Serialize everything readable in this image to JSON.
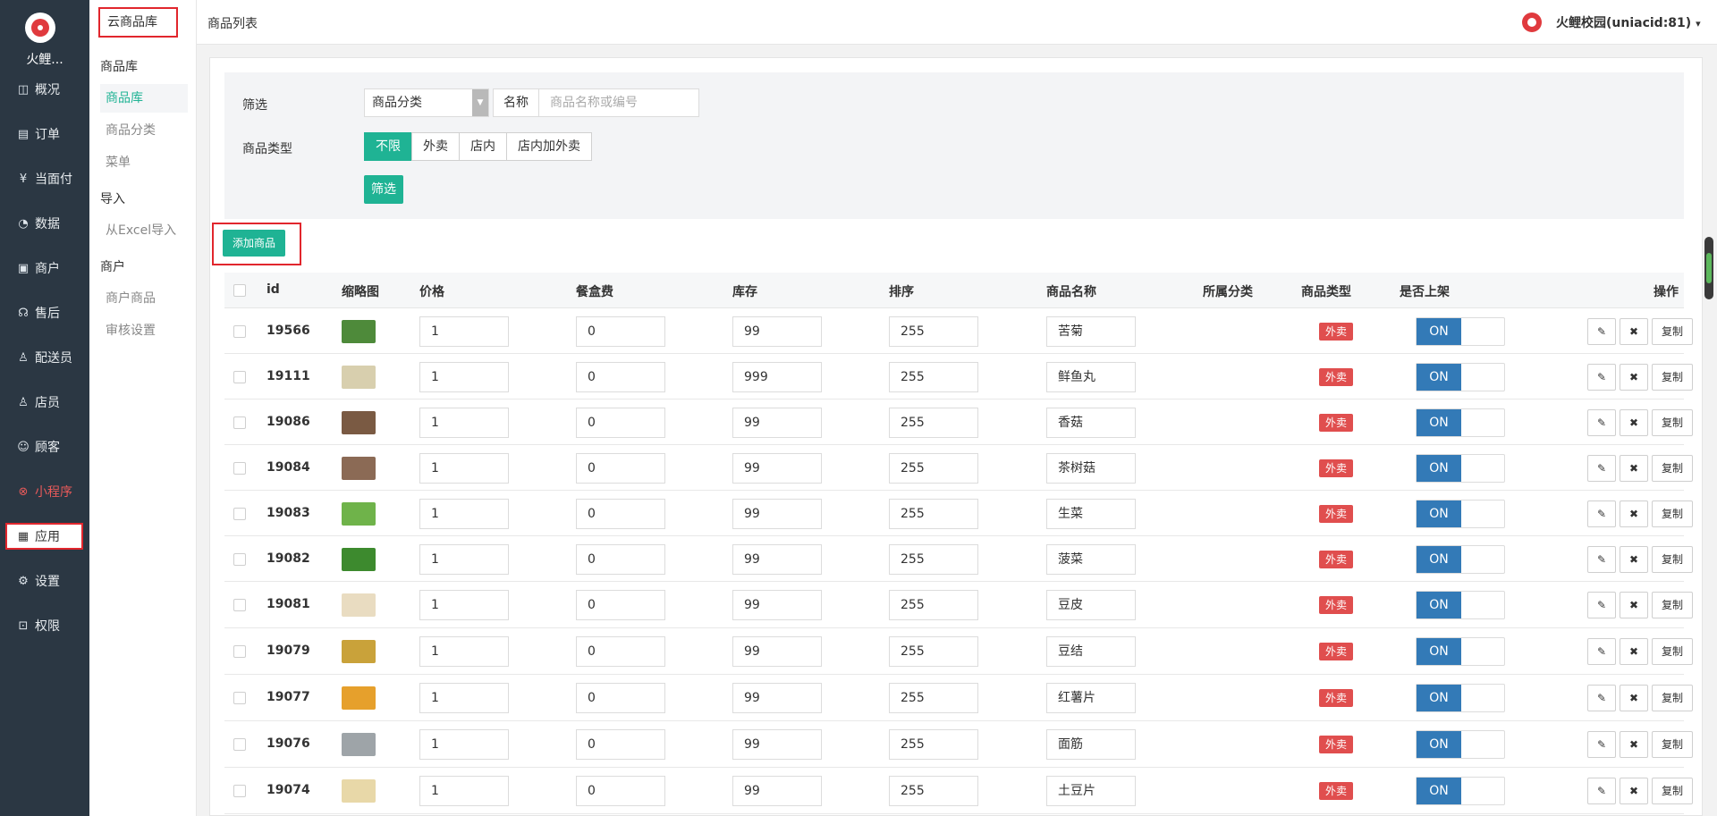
{
  "nav": {
    "brand": "火鲤...",
    "items": [
      {
        "label": "概况",
        "icon": "dashboard-icon",
        "glyph": "◫"
      },
      {
        "label": "订单",
        "icon": "order-icon",
        "glyph": "▤"
      },
      {
        "label": "当面付",
        "icon": "yen-icon",
        "glyph": "¥"
      },
      {
        "label": "数据",
        "icon": "chart-icon",
        "glyph": "◔"
      },
      {
        "label": "商户",
        "icon": "store-icon",
        "glyph": "▣"
      },
      {
        "label": "售后",
        "icon": "headset-icon",
        "glyph": "☊"
      },
      {
        "label": "配送员",
        "icon": "courier-icon",
        "glyph": "♙"
      },
      {
        "label": "店员",
        "icon": "clerk-icon",
        "glyph": "♙"
      },
      {
        "label": "顾客",
        "icon": "customer-icon",
        "glyph": "☺"
      },
      {
        "label": "小程序",
        "icon": "miniprogram-icon",
        "glyph": "⊗"
      },
      {
        "label": "应用",
        "icon": "apps-icon",
        "glyph": "▦"
      },
      {
        "label": "设置",
        "icon": "gear-icon",
        "glyph": "⚙"
      },
      {
        "label": "权限",
        "icon": "lock-icon",
        "glyph": "⊡"
      }
    ]
  },
  "submenu": {
    "top": "云商品库",
    "group1": "商品库",
    "item_goods": "商品库",
    "item_category": "商品分类",
    "item_menu": "菜单",
    "group2": "导入",
    "item_excel": "从Excel导入",
    "group3": "商户",
    "item_merchant_goods": "商户商品",
    "item_audit": "审核设置"
  },
  "header": {
    "breadcrumb": "商品列表",
    "user": "火鲤校园(uniacid:81)",
    "caret": "▾"
  },
  "filter": {
    "label": "筛选",
    "category_select": "商品分类",
    "name_addon": "名称",
    "name_placeholder": "商品名称或编号",
    "type_label": "商品类型",
    "types": [
      "不限",
      "外卖",
      "店内",
      "店内加外卖"
    ],
    "submit": "筛选"
  },
  "add_button": "添加商品",
  "table": {
    "columns": {
      "id": "id",
      "thumb": "缩略图",
      "price": "价格",
      "box_fee": "餐盒费",
      "stock": "库存",
      "sort": "排序",
      "name": "商品名称",
      "category": "所属分类",
      "type": "商品类型",
      "on_shelf": "是否上架",
      "ops": "操作"
    },
    "toggle_on": "ON",
    "op_edit": "✎",
    "op_delete": "✖",
    "op_copy": "复制",
    "rows": [
      {
        "id": "19566",
        "price": "1",
        "box_fee": "0",
        "stock": "99",
        "sort": "255",
        "name": "苦菊",
        "type": "外卖",
        "color": "#4e8a3a"
      },
      {
        "id": "19111",
        "price": "1",
        "box_fee": "0",
        "stock": "999",
        "sort": "255",
        "name": "鲜鱼丸",
        "type": "外卖",
        "color": "#d8cfae"
      },
      {
        "id": "19086",
        "price": "1",
        "box_fee": "0",
        "stock": "99",
        "sort": "255",
        "name": "香菇",
        "type": "外卖",
        "color": "#7a5a43"
      },
      {
        "id": "19084",
        "price": "1",
        "box_fee": "0",
        "stock": "99",
        "sort": "255",
        "name": "茶树菇",
        "type": "外卖",
        "color": "#8b6a55"
      },
      {
        "id": "19083",
        "price": "1",
        "box_fee": "0",
        "stock": "99",
        "sort": "255",
        "name": "生菜",
        "type": "外卖",
        "color": "#6fb34a"
      },
      {
        "id": "19082",
        "price": "1",
        "box_fee": "0",
        "stock": "99",
        "sort": "255",
        "name": "菠菜",
        "type": "外卖",
        "color": "#3d8a2e"
      },
      {
        "id": "19081",
        "price": "1",
        "box_fee": "0",
        "stock": "99",
        "sort": "255",
        "name": "豆皮",
        "type": "外卖",
        "color": "#e9dcc1"
      },
      {
        "id": "19079",
        "price": "1",
        "box_fee": "0",
        "stock": "99",
        "sort": "255",
        "name": "豆结",
        "type": "外卖",
        "color": "#c9a23a"
      },
      {
        "id": "19077",
        "price": "1",
        "box_fee": "0",
        "stock": "99",
        "sort": "255",
        "name": "红薯片",
        "type": "外卖",
        "color": "#e6a02c"
      },
      {
        "id": "19076",
        "price": "1",
        "box_fee": "0",
        "stock": "99",
        "sort": "255",
        "name": "面筋",
        "type": "外卖",
        "color": "#9ea4a8"
      },
      {
        "id": "19074",
        "price": "1",
        "box_fee": "0",
        "stock": "99",
        "sort": "255",
        "name": "土豆片",
        "type": "外卖",
        "color": "#e8d8a8"
      }
    ]
  }
}
